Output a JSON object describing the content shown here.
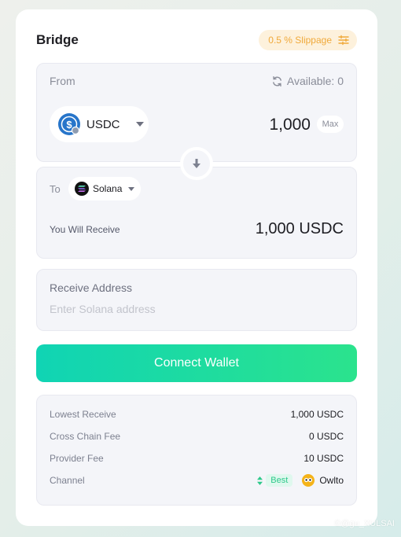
{
  "header": {
    "title": "Bridge",
    "slippage_label": "0.5 % Slippage"
  },
  "from": {
    "label": "From",
    "available": "Available: 0",
    "token": "USDC",
    "amount": "1,000",
    "max_label": "Max"
  },
  "to": {
    "label": "To",
    "chain": "Solana",
    "receive_label": "You Will Receive",
    "receive_value": "1,000 USDC"
  },
  "address": {
    "label": "Receive Address",
    "placeholder": "Enter Solana address"
  },
  "connect_label": "Connect Wallet",
  "details": {
    "rows": [
      {
        "label": "Lowest Receive",
        "value": "1,000 USDC"
      },
      {
        "label": "Cross Chain Fee",
        "value": "0 USDC"
      },
      {
        "label": "Provider Fee",
        "value": "10 USDC"
      }
    ],
    "channel": {
      "label": "Channel",
      "badge": "Best",
      "provider": "Owlto"
    }
  },
  "watermark": "©@gu_XULSAI",
  "colors": {
    "accent_start": "#10d4b4",
    "accent_end": "#2be38d",
    "slippage": "#f0a93a",
    "usdc": "#2775ca"
  }
}
